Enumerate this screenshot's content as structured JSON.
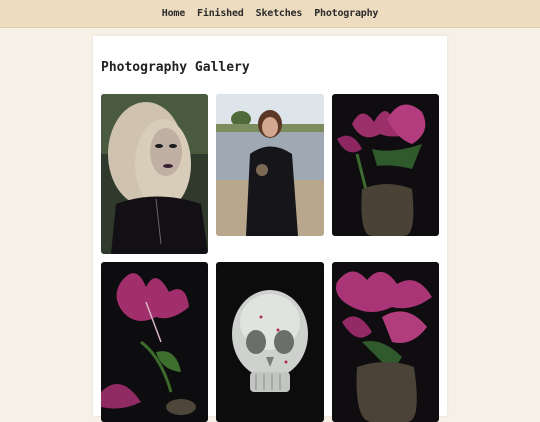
{
  "nav": {
    "items": [
      {
        "label": "Home"
      },
      {
        "label": "Finished"
      },
      {
        "label": "Sketches"
      },
      {
        "label": "Photography"
      }
    ]
  },
  "gallery": {
    "title": "Photography Gallery",
    "photos": [
      {
        "subject": "portrait-blonde-woman"
      },
      {
        "subject": "woman-by-river"
      },
      {
        "subject": "pink-lilies-vase"
      },
      {
        "subject": "pink-lily-closeup"
      },
      {
        "subject": "crystal-skull"
      },
      {
        "subject": "pink-lilies-vase"
      }
    ]
  }
}
